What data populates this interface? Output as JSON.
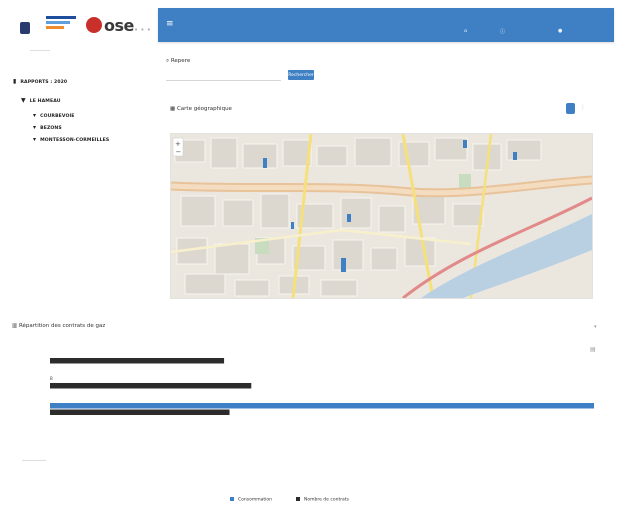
{
  "brand": {
    "name": "ose"
  },
  "topbar": {
    "links": [
      {
        "label": "",
        "icon": "home-icon"
      },
      {
        "label": "",
        "icon": "info-icon"
      },
      {
        "label": "",
        "icon": "user-icon"
      }
    ]
  },
  "sidebar": {
    "items": [
      {
        "label": "RAPPORTS : 2020",
        "icon": "home-icon"
      },
      {
        "label": "LE HAMEAU",
        "icon": "bookmark-icon"
      },
      {
        "label": "COURBEVOIE",
        "icon": "caret-icon"
      },
      {
        "label": "BEZONS",
        "icon": "caret-icon"
      },
      {
        "label": "MONTESSON-CORMEILLES",
        "icon": "caret-icon"
      }
    ]
  },
  "search": {
    "label": "Repere",
    "placeholder": "",
    "button_label": "Rechercher"
  },
  "map": {
    "title": "Carte géographique",
    "subtitle": ""
  },
  "chart": {
    "title": "Répartition des contrats de gaz",
    "legend": [
      {
        "label": "Consommation",
        "color": "#3f80c4"
      },
      {
        "label": "Nombre de contrats",
        "color": "#2c2c2c"
      }
    ]
  },
  "chart_data": {
    "type": "bar",
    "orientation": "horizontal",
    "title": "Répartition des contrats de gaz",
    "categories": [
      "",
      "B",
      ""
    ],
    "series": [
      {
        "name": "Consommation",
        "color": "#3f80c4",
        "values": [
          0,
          0,
          100
        ]
      },
      {
        "name": "Nombre de contrats",
        "color": "#2c2c2c",
        "values": [
          32,
          37,
          33
        ]
      }
    ],
    "xlim": [
      0,
      100
    ],
    "legend": "bottom"
  }
}
